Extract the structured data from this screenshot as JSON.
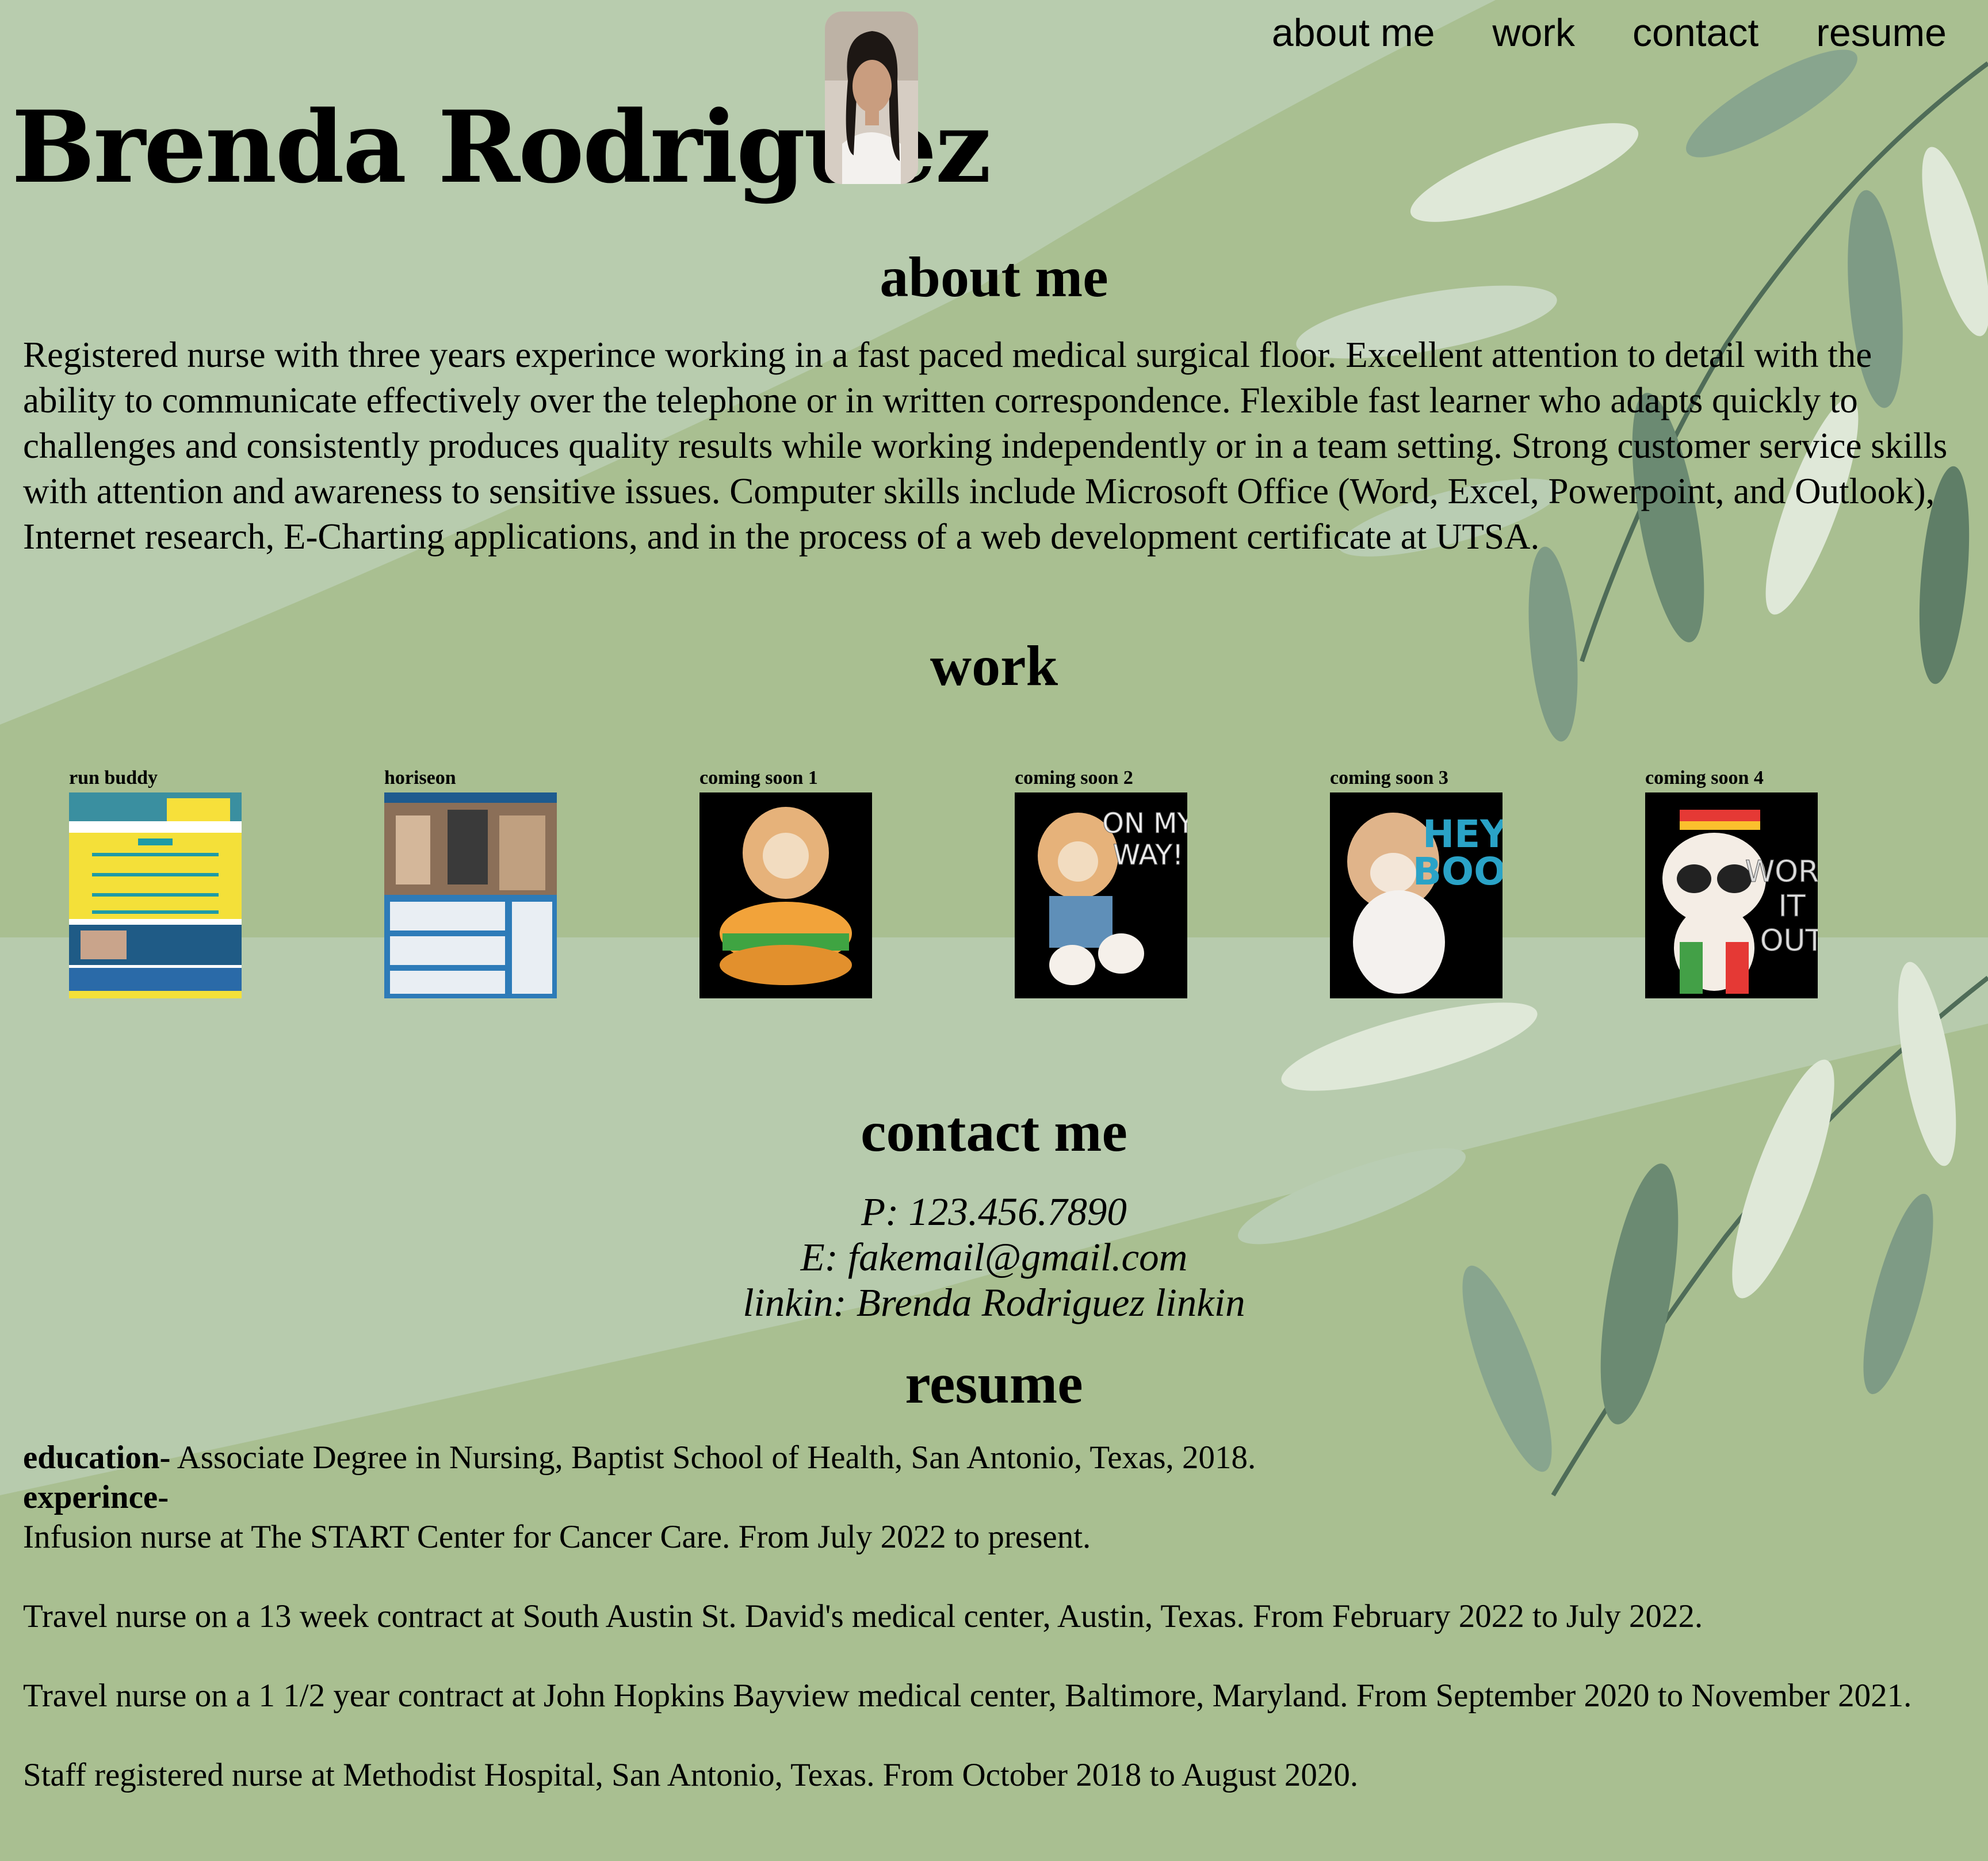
{
  "header": {
    "name": "Brenda Rodriguez",
    "nav": [
      "about me",
      "work",
      "contact",
      "resume"
    ]
  },
  "about": {
    "heading": "about me",
    "text": "Registered nurse with three years experince working in a fast paced medical surgical floor. Excellent attention to detail with the ability to communicate effectively over the telephone or in written correspondence. Flexible fast learner who adapts quickly to challenges and consistently produces quality results while working independently or in a team setting. Strong customer service skills with attention and awareness to sensitive issues. Computer skills include Microsoft Office (Word, Excel, Powerpoint, and Outlook), Internet research, E-Charting applications, and in the process of a web development certificate at UTSA."
  },
  "work": {
    "heading": "work",
    "projects": [
      {
        "label": "run buddy"
      },
      {
        "label": "horiseon"
      },
      {
        "label": "coming soon 1"
      },
      {
        "label": "coming soon 2",
        "overlay": "ON MY WAY!"
      },
      {
        "label": "coming soon 3",
        "overlay": "HEY BOO"
      },
      {
        "label": "coming soon 4",
        "overlay": "WORK IT OUT"
      }
    ]
  },
  "contact": {
    "heading": "contact me",
    "phone": "P: 123.456.7890",
    "email": "E: fakemail@gmail.com",
    "linkedin": "linkin: Brenda Rodriguez linkin"
  },
  "resume": {
    "heading": "resume",
    "education_label": "education-",
    "education_text": " Associate Degree in Nursing, Baptist School of Health, San Antonio, Texas, 2018.",
    "experience_label": "experince-",
    "jobs": [
      "Infusion nurse at The START Center for Cancer Care. From July 2022 to present.",
      "Travel nurse on a 13 week contract at South Austin St. David's medical center, Austin, Texas. From February 2022 to July 2022.",
      "Travel nurse on a 1 1/2 year contract at John Hopkins Bayview medical center, Baltimore, Maryland. From September 2020 to November 2021.",
      "Staff registered nurse at Methodist Hospital, San Antonio, Texas. From October 2018 to August 2020."
    ]
  },
  "colors": {
    "background": "#a9bf91",
    "light_band": "#b9cdb0",
    "leaf_dark": "#6b8a72",
    "leaf_light": "#dfe8d8"
  }
}
